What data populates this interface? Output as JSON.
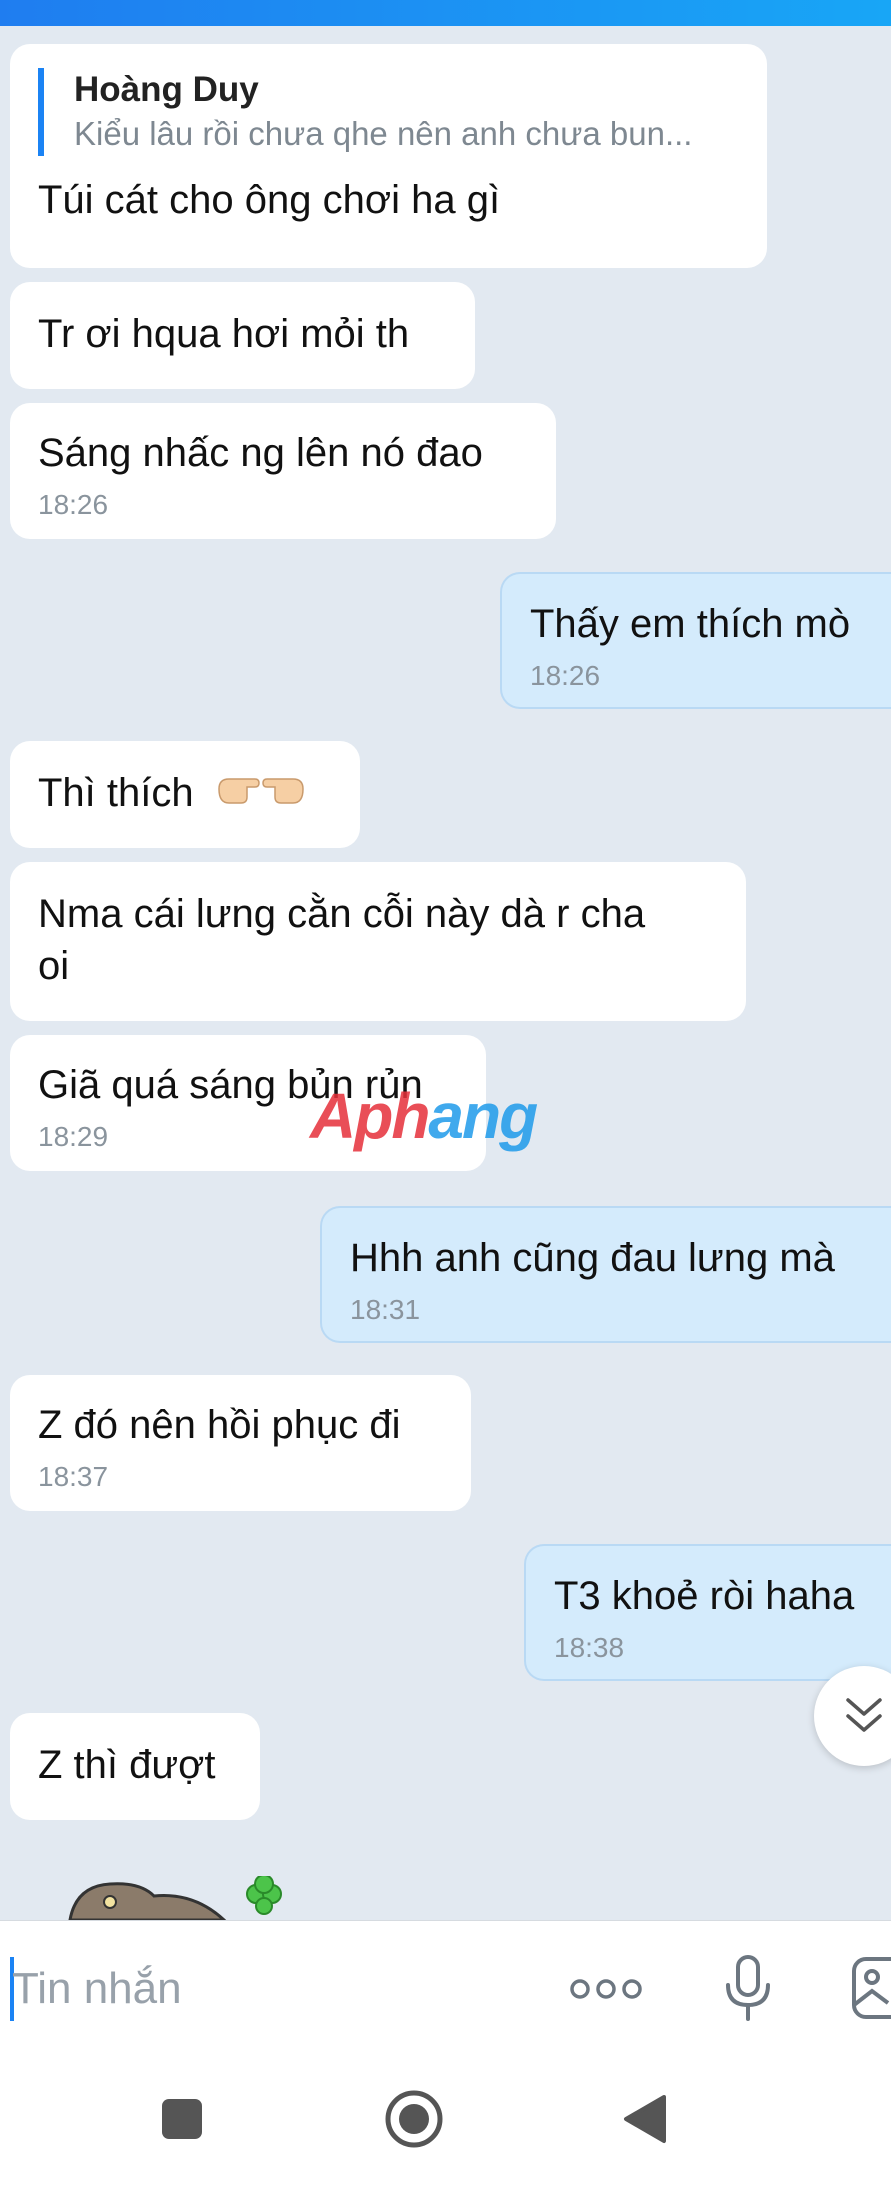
{
  "messages": [
    {
      "side": "in",
      "quote_name": "Hoàng Duy",
      "quote_text": "Kiểu lâu rồi chưa qhe nên anh chưa bun...",
      "text": "Túi cát cho ông chơi ha gì"
    },
    {
      "side": "in",
      "text": "Tr ơi hqua hơi mỏi th"
    },
    {
      "side": "in",
      "text": "Sáng nhấc ng lên nó đao",
      "time": "18:26"
    },
    {
      "side": "out",
      "text": "Thấy em thích mò",
      "time": "18:26"
    },
    {
      "side": "in",
      "text": "Thì thích",
      "emoji": "pointing-hands-emoji"
    },
    {
      "side": "in",
      "text": "Nma cái lưng cằn cỗi này dà r cha",
      "text2": "oi"
    },
    {
      "side": "in",
      "text": "Giã quá sáng bủn rủn",
      "time": "18:29"
    },
    {
      "side": "out",
      "text": "Hhh anh cũng đau lưng mà",
      "time": "18:31"
    },
    {
      "side": "in",
      "text": "Z đó nên hồi phục đi",
      "time": "18:37"
    },
    {
      "side": "out",
      "text": "T3 khoẻ ròi haha",
      "time": "18:38"
    },
    {
      "side": "in",
      "text": "Z thì đượt"
    }
  ],
  "watermark": {
    "part1": "Aph",
    "part2": "ang"
  },
  "composer": {
    "placeholder": "Tin nhắn"
  },
  "icons": {
    "scroll_down": "double-chevron-down-icon",
    "more": "more-dots-icon",
    "mic": "microphone-icon",
    "image": "image-icon",
    "nav_recent": "square-icon",
    "nav_home": "circle-icon",
    "nav_back": "triangle-back-icon"
  },
  "colors": {
    "accent": "#1b83f4",
    "incoming_bubble": "#ffffff",
    "outgoing_bubble": "#d4ebfc",
    "background": "#e2e9f1"
  }
}
